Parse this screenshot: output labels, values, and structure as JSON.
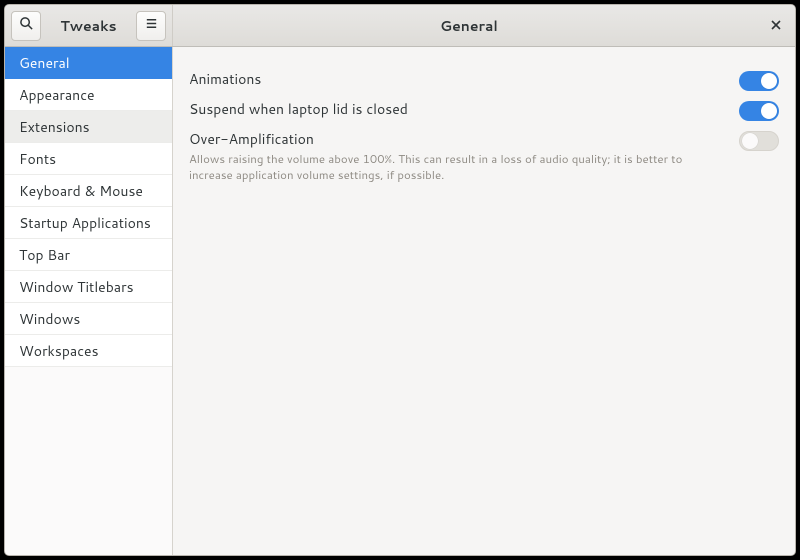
{
  "header": {
    "app_title": "Tweaks",
    "page_title": "General"
  },
  "sidebar": {
    "items": [
      {
        "label": "General",
        "selected": true
      },
      {
        "label": "Appearance",
        "selected": false
      },
      {
        "label": "Extensions",
        "selected": false,
        "hover": true
      },
      {
        "label": "Fonts",
        "selected": false
      },
      {
        "label": "Keyboard & Mouse",
        "selected": false
      },
      {
        "label": "Startup Applications",
        "selected": false
      },
      {
        "label": "Top Bar",
        "selected": false
      },
      {
        "label": "Window Titlebars",
        "selected": false
      },
      {
        "label": "Windows",
        "selected": false
      },
      {
        "label": "Workspaces",
        "selected": false
      }
    ]
  },
  "settings": {
    "animations": {
      "label": "Animations",
      "value": true
    },
    "suspend_lid": {
      "label": "Suspend when laptop lid is closed",
      "value": true
    },
    "over_amp": {
      "label": "Over-Amplification",
      "description": "Allows raising the volume above 100%. This can result in a loss of audio quality; it is better to increase application volume settings, if possible.",
      "value": false
    }
  }
}
